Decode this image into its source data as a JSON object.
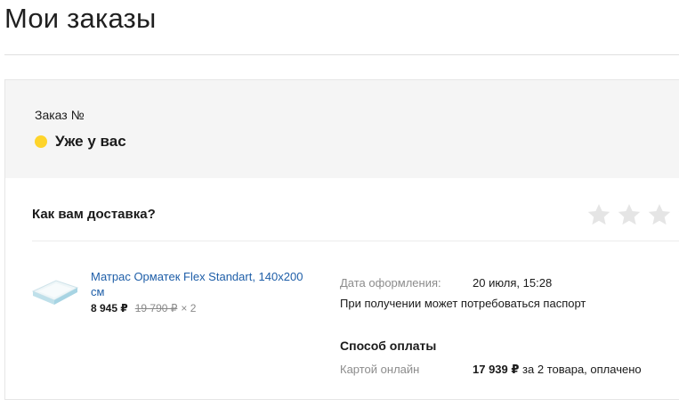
{
  "page": {
    "title": "Мои заказы"
  },
  "order": {
    "number_label": "Заказ №",
    "status": "Уже у вас",
    "status_color": "#fed42b",
    "feedback": {
      "question": "Как вам доставка?",
      "stars_total": 4,
      "stars_selected": 0
    },
    "item": {
      "name": "Матрас Орматек Flex Standart, 140x200 см",
      "price": "8 945 ₽",
      "old_price": "19 790 ₽",
      "quantity": "× 2",
      "thumbnail_icon": "mattress-icon"
    },
    "details": {
      "date_label": "Дата оформления:",
      "date_value": "20 июля, 15:28",
      "passport_note": "При получении может потребоваться паспорт"
    },
    "payment": {
      "title": "Способ оплаты",
      "method_label": "Картой онлайн",
      "amount": "17 939 ₽",
      "summary": "за 2 товара, оплачено"
    }
  }
}
